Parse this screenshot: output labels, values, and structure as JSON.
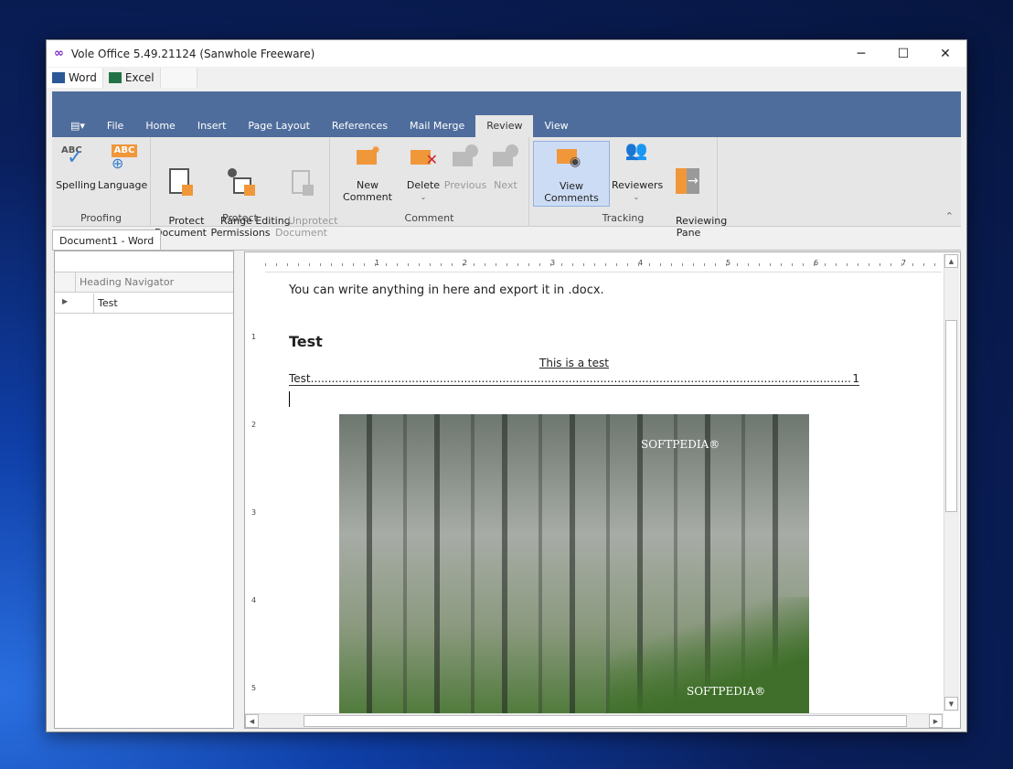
{
  "window": {
    "title": "Vole Office 5.49.21124 (Sanwhole Freeware)",
    "minimize": "─",
    "maximize": "☐",
    "close": "✕"
  },
  "app_tabs": [
    {
      "label": "Word"
    },
    {
      "label": "Excel"
    }
  ],
  "ribbon": {
    "tabs": [
      "File",
      "Home",
      "Insert",
      "Page Layout",
      "References",
      "Mail Merge",
      "Review",
      "View"
    ],
    "active_tab": "Review",
    "groups": {
      "proofing": {
        "label": "Proofing",
        "buttons": [
          "Spelling",
          "Language"
        ]
      },
      "protect": {
        "label": "Protect",
        "buttons": [
          "Protect\nDocument",
          "Range Editing\nPermissions",
          "Unprotect\nDocument"
        ]
      },
      "comment": {
        "label": "Comment",
        "buttons": [
          "New Comment",
          "Delete",
          "Previous",
          "Next"
        ]
      },
      "tracking": {
        "label": "Tracking",
        "buttons": [
          "View Comments",
          "Reviewers",
          "Reviewing\nPane"
        ]
      }
    },
    "accent": "#f0973a",
    "header_color": "#4f6d9c"
  },
  "document_tab": "Document1 - Word",
  "navigator": {
    "header": "Heading Navigator",
    "items": [
      "Test"
    ]
  },
  "ruler": {
    "h": [
      "1",
      "2",
      "3",
      "4",
      "5",
      "6",
      "7"
    ],
    "v": [
      "1",
      "2",
      "3",
      "4",
      "5"
    ]
  },
  "doc": {
    "line1": "You can write anything in here and export it in .docx.",
    "heading": "Test",
    "centered": "This is a test",
    "toc_entry": "Test",
    "toc_page": "1",
    "image_watermark": "SOFTPEDIA"
  }
}
